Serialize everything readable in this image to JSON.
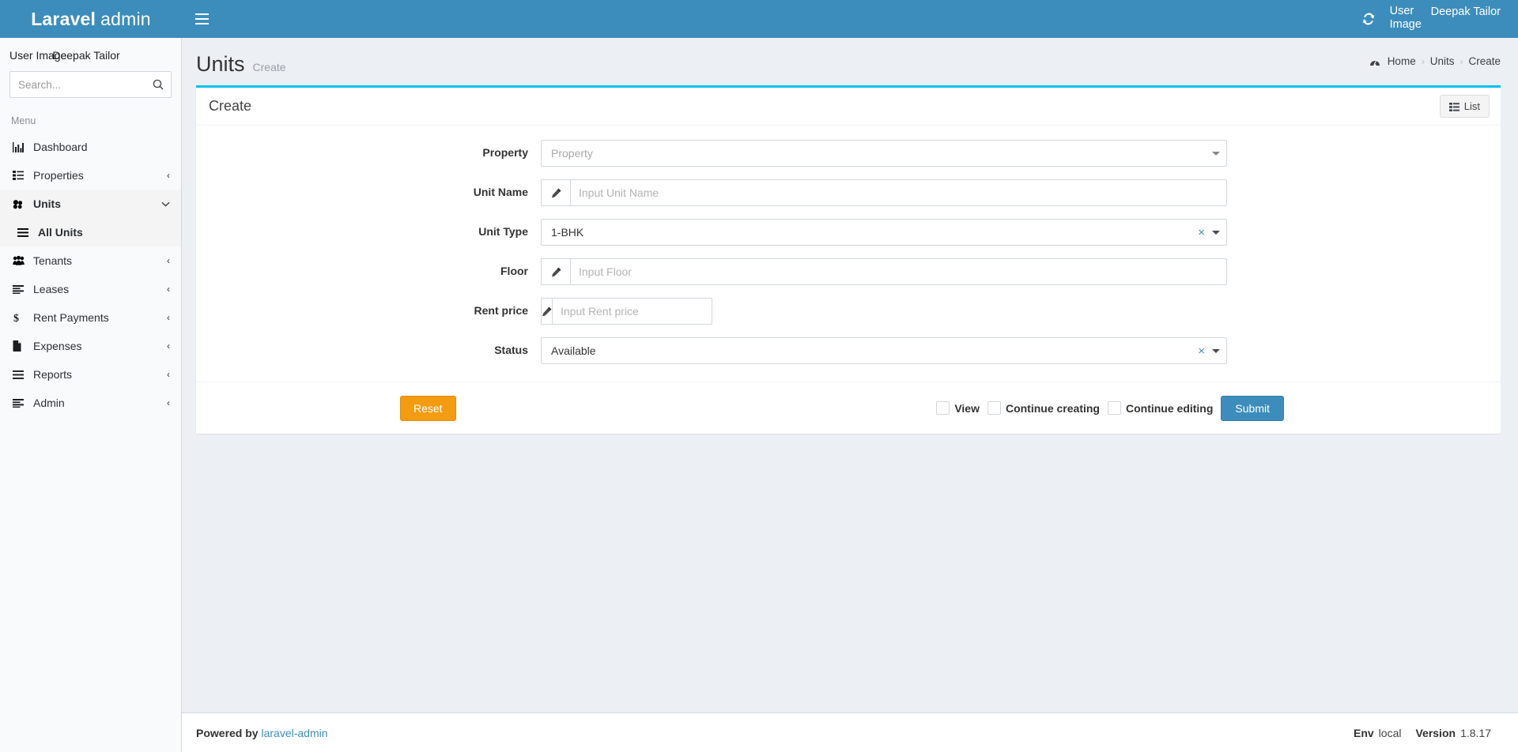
{
  "navbar": {
    "brand_bold": "Laravel",
    "brand_light": "admin",
    "toggle_icon": "hamburger-icon",
    "refresh_icon": "refresh-icon",
    "user_image_alt": "User Image",
    "user_name": "Deepak Tailor",
    "bg_color": "#3c8dbc"
  },
  "sidebar": {
    "user_panel": {
      "image_alt": "User Image",
      "name": "Deepak Tailor"
    },
    "search": {
      "placeholder": "Search...",
      "value": "",
      "icon": "search-icon"
    },
    "menu_header": "Menu",
    "items": [
      {
        "label": "Dashboard",
        "icon": "bar-chart-icon",
        "caret": "",
        "active": false
      },
      {
        "label": "Properties",
        "icon": "list-alt-icon",
        "caret": "‹",
        "active": false
      },
      {
        "label": "Units",
        "icon": "cubes-icon",
        "caret": "⌄",
        "active": true
      },
      {
        "label": "Tenants",
        "icon": "users-icon",
        "caret": "‹",
        "active": false
      },
      {
        "label": "Leases",
        "icon": "list-icon",
        "caret": "‹",
        "active": false
      },
      {
        "label": "Rent Payments",
        "icon": "dollar-icon",
        "caret": "‹",
        "active": false
      },
      {
        "label": "Expenses",
        "icon": "file-icon",
        "caret": "‹",
        "active": false
      },
      {
        "label": "Reports",
        "icon": "bars-icon",
        "caret": "‹",
        "active": false
      },
      {
        "label": "Admin",
        "icon": "list-icon",
        "caret": "‹",
        "active": false
      }
    ],
    "submenu": [
      {
        "label": "All Units",
        "icon": "bars-icon",
        "active": true
      }
    ]
  },
  "page": {
    "title": "Units",
    "subtitle": "Create",
    "breadcrumb": {
      "home_icon": "dashboard-icon",
      "items": [
        "Home",
        "Units",
        "Create"
      ],
      "separator": "›"
    }
  },
  "box": {
    "title": "Create",
    "accent_color": "#00c0ef",
    "list_button": {
      "label": "List",
      "icon": "list-icon"
    }
  },
  "form": {
    "fields": [
      {
        "label": "Property",
        "type": "select",
        "value": "Property",
        "is_placeholder": true,
        "clearable": false
      },
      {
        "label": "Unit Name",
        "type": "input",
        "value": "",
        "placeholder": "Input Unit Name",
        "addon_icon": "pencil-icon"
      },
      {
        "label": "Unit Type",
        "type": "select",
        "value": "1-BHK",
        "is_placeholder": false,
        "clearable": true,
        "clear_symbol": "×"
      },
      {
        "label": "Floor",
        "type": "input",
        "value": "",
        "placeholder": "Input Floor",
        "addon_icon": "pencil-icon"
      },
      {
        "label": "Rent price",
        "type": "input-narrow",
        "value": "",
        "placeholder": "Input Rent price",
        "addon_icon": "pencil-icon"
      },
      {
        "label": "Status",
        "type": "select",
        "value": "Available",
        "is_placeholder": false,
        "clearable": true,
        "clear_symbol": "×"
      }
    ]
  },
  "actions": {
    "reset_label": "Reset",
    "reset_color": "#f39c12",
    "submit_label": "Submit",
    "submit_color": "#3c8dbc",
    "checkboxes": [
      {
        "label": "View",
        "checked": false
      },
      {
        "label": "Continue creating",
        "checked": false
      },
      {
        "label": "Continue editing",
        "checked": false
      }
    ]
  },
  "footer": {
    "powered_by": "Powered by",
    "link_text": "laravel-admin",
    "env_label": "Env",
    "env_value": "local",
    "version_label": "Version",
    "version_value": "1.8.17"
  }
}
